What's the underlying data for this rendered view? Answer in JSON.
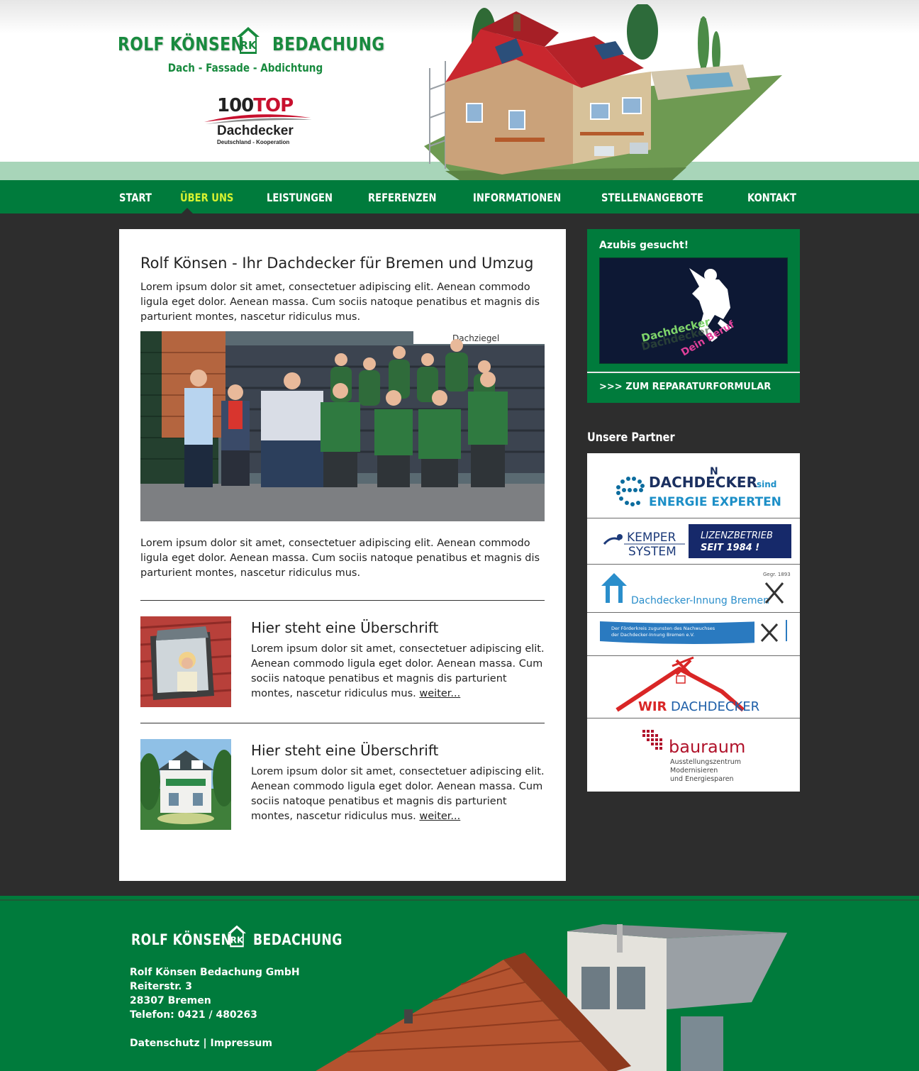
{
  "header": {
    "brand_left": "ROLF KÖNSEN",
    "brand_right": "BEDACHUNG",
    "logo_letters": "RK",
    "tagline": "Dach - Fassade - Abdichtung",
    "toplogo_100": "100",
    "toplogo_top": "TOP",
    "toplogo_dachdecker": "Dachdecker",
    "toplogo_sub": "Deutschland - Kooperation"
  },
  "nav": {
    "items": [
      {
        "label": "START"
      },
      {
        "label": "ÜBER UNS",
        "active": true
      },
      {
        "label": "LEISTUNGEN"
      },
      {
        "label": "REFERENZEN"
      },
      {
        "label": "INFORMATIONEN"
      },
      {
        "label": "STELLENANGEBOTE"
      },
      {
        "label": "KONTAKT"
      }
    ]
  },
  "main": {
    "title": "Rolf Könsen - Ihr Dachdecker für Bremen und Umzug",
    "intro": "Lorem ipsum dolor sit amet, consectetuer adipiscing elit. Aenean commodo ligula eget dolor. Aenean massa. Cum sociis natoque penatibus et magnis dis parturient montes, nascetur ridiculus mus.",
    "photo_sign": "Dachziegel",
    "outro": "Lorem ipsum dolor sit amet, consectetuer adipiscing elit. Aenean commodo ligula eget dolor. Aenean massa. Cum sociis natoque penatibus et magnis dis parturient montes, nascetur ridiculus mus.",
    "teasers": [
      {
        "heading": "Hier steht eine Überschrift",
        "text": "Lorem ipsum dolor sit amet, consectetuer adipiscing elit. Aenean commodo ligula eget dolor. Aenean massa. Cum sociis natoque penatibus et magnis dis parturient montes, nascetur ridiculus mus.",
        "link": "weiter..."
      },
      {
        "heading": "Hier steht eine Überschrift",
        "text": "Lorem ipsum dolor sit amet, consectetuer adipiscing elit. Aenean commodo ligula eget dolor. Aenean massa. Cum sociis natoque penatibus et magnis dis parturient montes, nascetur ridiculus mus.",
        "link": "weiter..."
      }
    ]
  },
  "sidebar": {
    "azubi_title": "Azubis gesucht!",
    "azubi_img_text1": "Dachdecker",
    "azubi_img_text2": "Dein Beruf",
    "repair_link": ">>> ZUM REPARATURFORMULAR",
    "partner_title": "Unsere Partner",
    "partners": {
      "p1_line1": "DACHDECKER",
      "p1_sind": "sind",
      "p1_line2": "ENERGIE EXPERTEN",
      "p1_n": "N",
      "p2_kemper": "KEMPER",
      "p2_system": "SYSTEM",
      "p2_badge1": "LIZENZBETRIEB",
      "p2_badge2": "SEIT 1984 !",
      "p3_name": "Dachdecker-Innung Bremen",
      "p3_gegr": "Gegr. 1893",
      "p4_line1": "Der Förderkreis zugunsten des Nachwuchses",
      "p4_line2": "der Dachdecker-Innung Bremen e.V.",
      "p5_wir": "WIR",
      "p5_dach": "DACHDECKER",
      "p6_name": "bauraum",
      "p6_sub1": "Ausstellungszentrum",
      "p6_sub2": "Modernisieren",
      "p6_sub3": "und Energiesparen"
    }
  },
  "footer": {
    "brand_left": "ROLF KÖNSEN",
    "brand_right": "BEDACHUNG",
    "logo_letters": "RK",
    "company": "Rolf Könsen Bedachung GmbH",
    "street": "Reiterstr. 3",
    "city": "28307 Bremen",
    "phone": "Telefon: 0421 / 480263",
    "link_datenschutz": "Datenschutz",
    "separator": " | ",
    "link_impressum": "Impressum"
  },
  "colors": {
    "brand_green": "#007b3c",
    "logo_green": "#188a3e",
    "nav_active": "#d6f230",
    "page_dark": "#2d2d2d",
    "header_band": "#a8d5b9"
  }
}
